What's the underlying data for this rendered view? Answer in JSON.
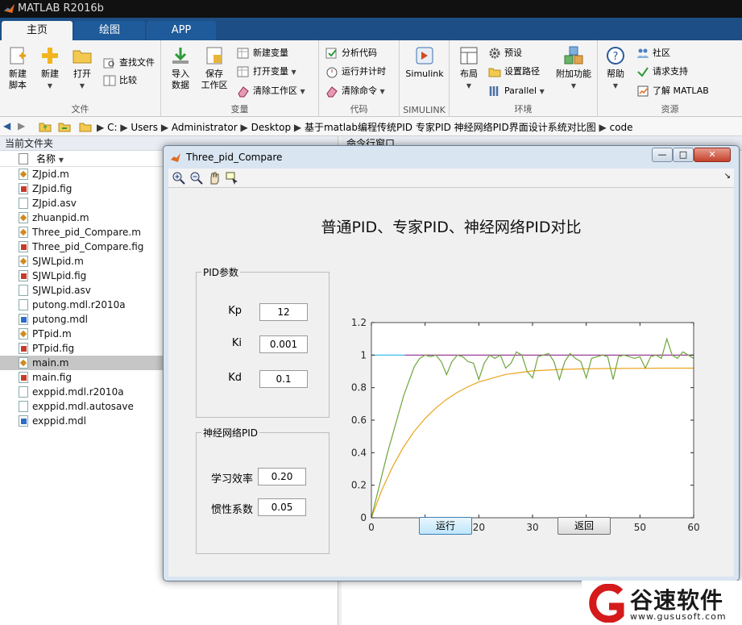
{
  "app": {
    "title": "MATLAB R2016b"
  },
  "tabs": [
    {
      "label": "主页"
    },
    {
      "label": "绘图"
    },
    {
      "label": "APP"
    }
  ],
  "ribbon": {
    "file": {
      "label": "文件",
      "new_script": "新建\n脚本",
      "new": "新建",
      "open": "打开",
      "find_files": "查找文件",
      "compare": "比较"
    },
    "variable": {
      "label": "变量",
      "import_data": "导入\n数据",
      "save_workspace": "保存\n工作区",
      "new_variable": "新建变量",
      "open_variable": "打开变量",
      "clear_workspace": "清除工作区"
    },
    "code": {
      "label": "代码",
      "analyze_code": "分析代码",
      "run_and_time": "运行并计时",
      "clear_commands": "清除命令"
    },
    "simulink": {
      "label": "SIMULINK",
      "button": "Simulink"
    },
    "environment": {
      "label": "环境",
      "layout": "布局",
      "preferences": "预设",
      "set_path": "设置路径",
      "parallel": "Parallel",
      "addons": "附加功能"
    },
    "resources": {
      "label": "资源",
      "help": "帮助",
      "community": "社区",
      "request_support": "请求支持",
      "learn_matlab": "了解 MATLAB"
    }
  },
  "address": {
    "path": [
      "C:",
      "Users",
      "Administrator",
      "Desktop",
      "基于matlab编程传统PID 专家PID 神经网络PID界面设计系统对比图",
      "code"
    ]
  },
  "file_panel": {
    "title": "当前文件夹",
    "column_name": "名称",
    "files": [
      {
        "name": "ZJpid.m",
        "type": "m"
      },
      {
        "name": "ZJpid.fig",
        "type": "fig"
      },
      {
        "name": "ZJpid.asv",
        "type": "asv"
      },
      {
        "name": "zhuanpid.m",
        "type": "m"
      },
      {
        "name": "Three_pid_Compare.m",
        "type": "m"
      },
      {
        "name": "Three_pid_Compare.fig",
        "type": "fig"
      },
      {
        "name": "SJWLpid.m",
        "type": "m"
      },
      {
        "name": "SJWLpid.fig",
        "type": "fig"
      },
      {
        "name": "SJWLpid.asv",
        "type": "asv"
      },
      {
        "name": "putong.mdl.r2010a",
        "type": "asv"
      },
      {
        "name": "putong.mdl",
        "type": "mdl"
      },
      {
        "name": "PTpid.m",
        "type": "m"
      },
      {
        "name": "PTpid.fig",
        "type": "fig"
      },
      {
        "name": "main.m",
        "type": "m",
        "selected": true
      },
      {
        "name": "main.fig",
        "type": "fig"
      },
      {
        "name": "exppid.mdl.r2010a",
        "type": "asv"
      },
      {
        "name": "exppid.mdl.autosave",
        "type": "asv"
      },
      {
        "name": "exppid.mdl",
        "type": "mdl"
      }
    ]
  },
  "command_window": {
    "title": "命令行窗口"
  },
  "figure": {
    "window_title": "Three_pid_Compare",
    "heading": "普通PID、专家PID、神经网络PID对比",
    "pid_panel": {
      "title": "PID参数",
      "kp_label": "Kp",
      "kp_value": "12",
      "ki_label": "Ki",
      "ki_value": "0.001",
      "kd_label": "Kd",
      "kd_value": "0.1"
    },
    "nn_panel": {
      "title": "神经网络PID",
      "lr_label": "学习效率",
      "lr_value": "0.20",
      "momentum_label": "惯性系数",
      "momentum_value": "0.05"
    },
    "run_button": "运行",
    "back_button": "返回"
  },
  "watermark": {
    "text": "谷速软件",
    "url": "www.gususoft.com"
  },
  "chart_data": {
    "type": "line",
    "xlim": [
      0,
      60
    ],
    "ylim": [
      0,
      1.2
    ],
    "xticks": [
      0,
      10,
      20,
      30,
      40,
      50,
      60
    ],
    "yticks": [
      0,
      0.2,
      0.4,
      0.6,
      0.8,
      1,
      1.2
    ],
    "grid": false,
    "series": [
      {
        "color": "#27b5e3",
        "x": [
          0,
          6.2
        ],
        "y": [
          1,
          1
        ]
      },
      {
        "color": "#8b2a8b",
        "x": [
          6.2,
          60
        ],
        "y": [
          1,
          1
        ]
      },
      {
        "color": "#eaa41a",
        "x": [
          0,
          2,
          4,
          6,
          8,
          10,
          12,
          14,
          16,
          18,
          20,
          25,
          30,
          35,
          40,
          45,
          50,
          55,
          60
        ],
        "y": [
          0,
          0.175,
          0.318,
          0.436,
          0.532,
          0.611,
          0.675,
          0.728,
          0.771,
          0.806,
          0.835,
          0.881,
          0.903,
          0.912,
          0.916,
          0.918,
          0.919,
          0.92,
          0.92
        ]
      },
      {
        "color": "#6fa53c",
        "x": [
          0,
          3,
          6,
          8,
          9,
          10,
          11,
          12,
          13,
          14,
          15,
          16,
          17,
          18,
          19,
          20,
          21,
          22,
          23,
          24,
          25,
          26,
          27,
          28,
          29,
          30,
          31,
          32,
          33,
          34,
          35,
          36,
          37,
          38,
          39,
          40,
          41,
          42,
          43,
          44,
          45,
          46,
          47,
          48,
          49,
          50,
          51,
          52,
          53,
          54,
          55,
          56,
          57,
          58,
          59,
          60
        ],
        "y": [
          0,
          0.4,
          0.75,
          0.93,
          0.98,
          1.0,
          0.99,
          1.0,
          0.96,
          0.88,
          0.96,
          1.0,
          0.99,
          0.96,
          0.95,
          0.85,
          0.95,
          1.0,
          0.98,
          1.0,
          0.92,
          0.95,
          1.02,
          1.0,
          0.9,
          0.86,
          0.99,
          1.0,
          1.01,
          0.96,
          0.85,
          0.96,
          1.01,
          0.98,
          0.96,
          0.86,
          0.98,
          0.99,
          1.0,
          0.99,
          0.85,
          0.99,
          1.0,
          0.99,
          0.98,
          0.99,
          0.92,
          0.99,
          1.0,
          0.98,
          1.1,
          1.0,
          0.98,
          1.02,
          1.0,
          0.98
        ]
      }
    ]
  }
}
